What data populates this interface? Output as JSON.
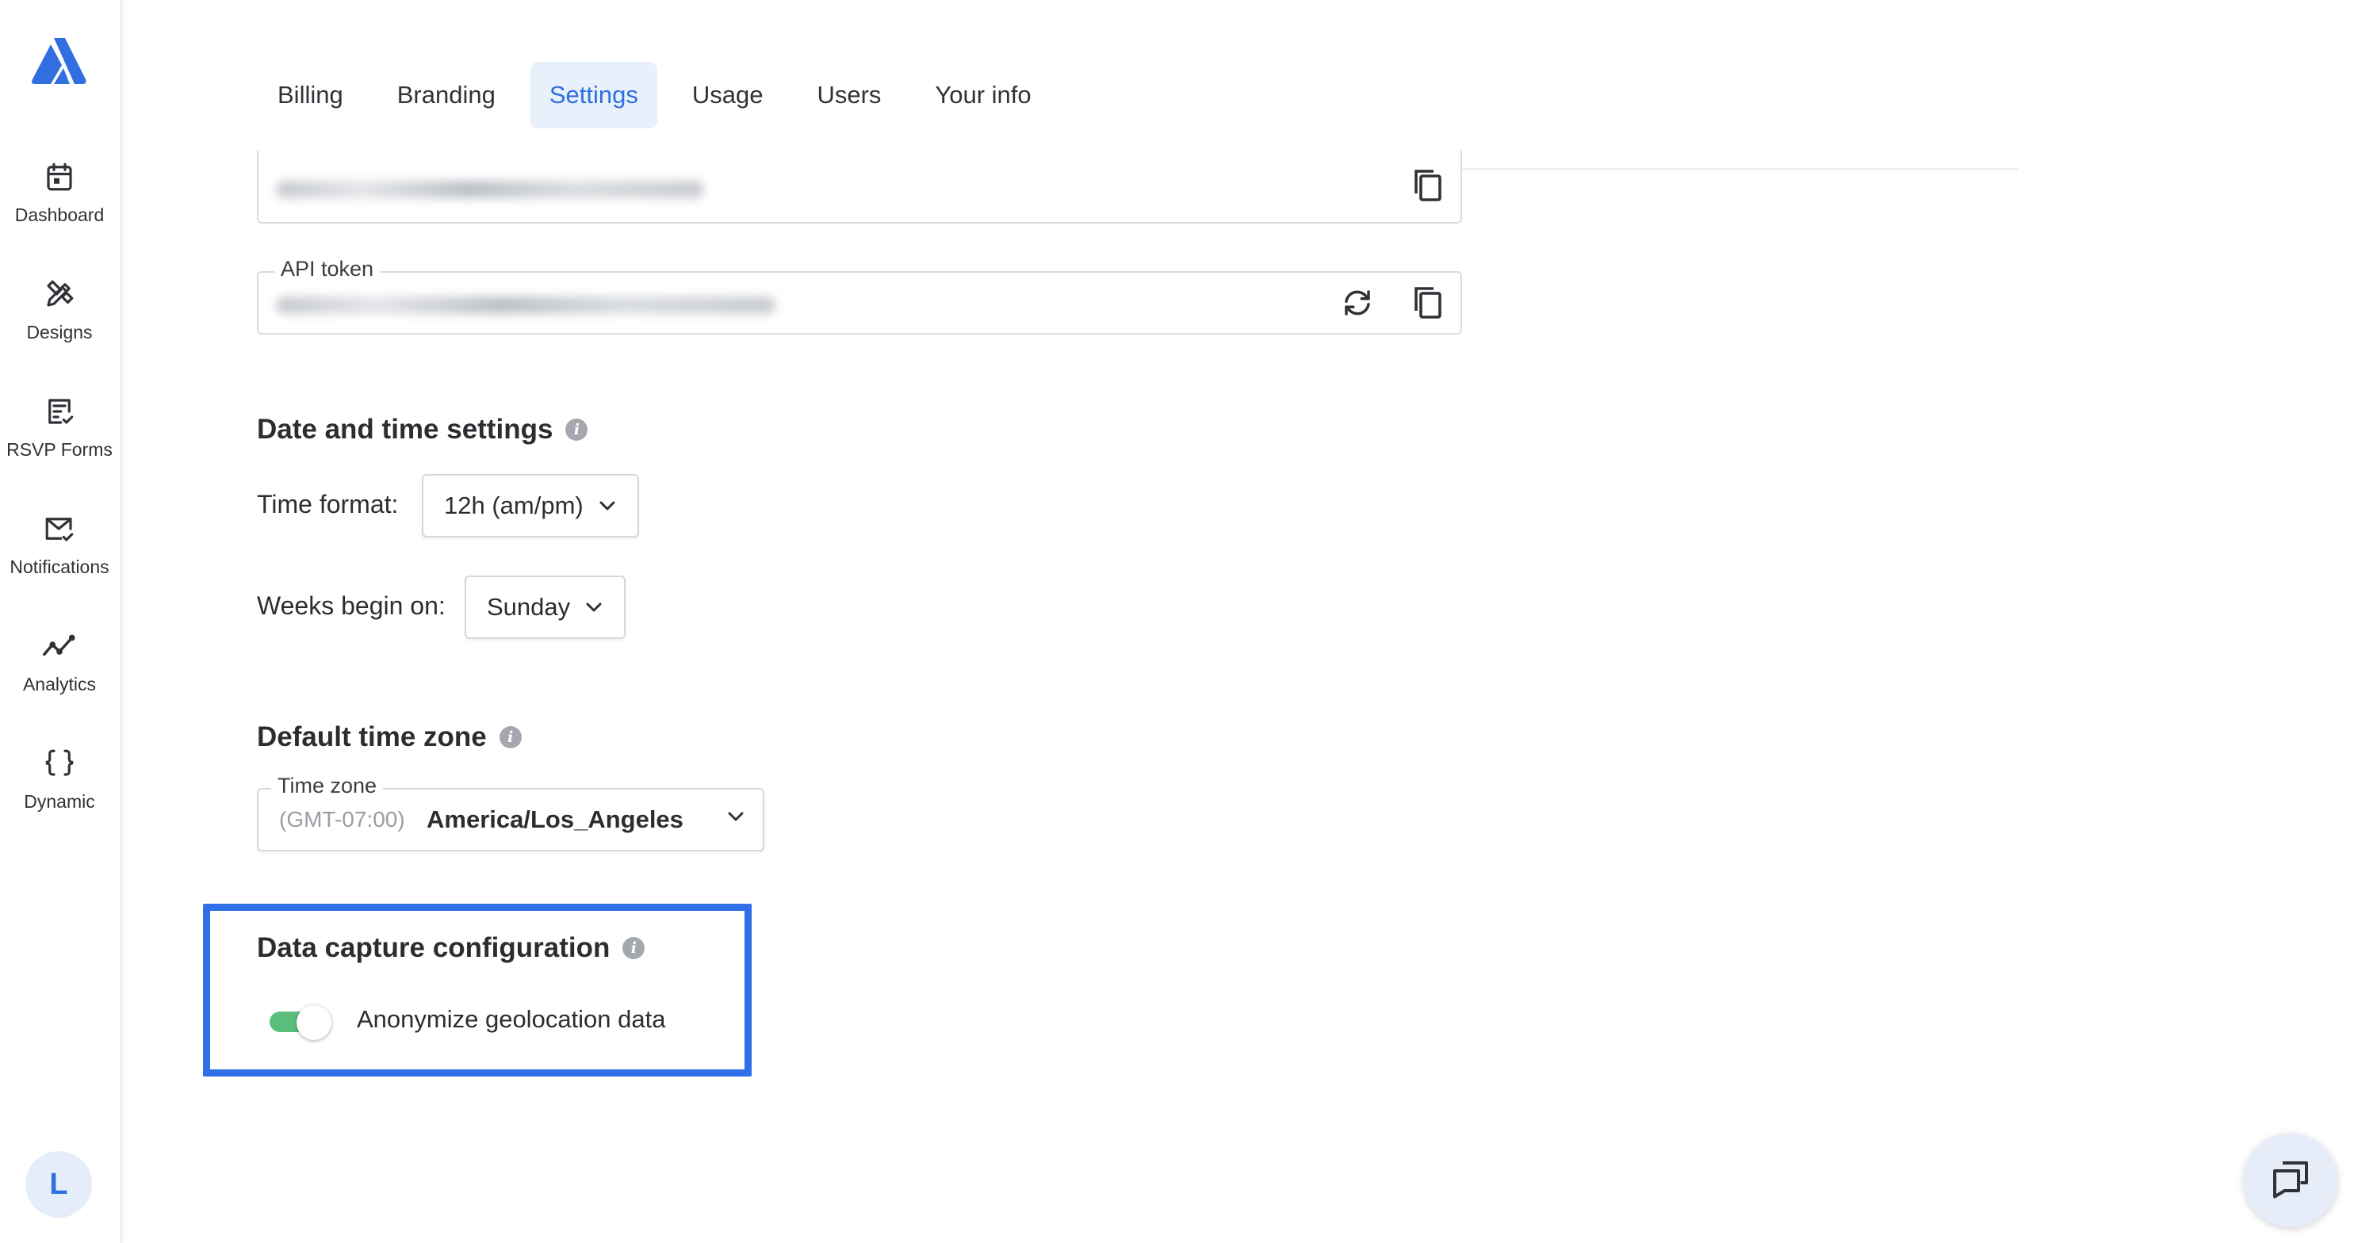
{
  "sidebar": {
    "logo": "app-logo",
    "items": [
      {
        "label": "Dashboard",
        "icon": "calendar-icon"
      },
      {
        "label": "Designs",
        "icon": "pencil-ruler-icon"
      },
      {
        "label": "RSVP Forms",
        "icon": "checklist-icon"
      },
      {
        "label": "Notifications",
        "icon": "mail-check-icon"
      },
      {
        "label": "Analytics",
        "icon": "line-chart-icon"
      },
      {
        "label": "Dynamic",
        "icon": "braces-icon"
      }
    ],
    "avatar_initial": "L"
  },
  "tabs": [
    {
      "label": "Billing",
      "active": false
    },
    {
      "label": "Branding",
      "active": false
    },
    {
      "label": "Settings",
      "active": true
    },
    {
      "label": "Usage",
      "active": false
    },
    {
      "label": "Users",
      "active": false
    },
    {
      "label": "Your info",
      "active": false
    }
  ],
  "tokens": {
    "api_token_label": "API token"
  },
  "date_time": {
    "title": "Date and time settings",
    "time_format_label": "Time format:",
    "time_format_value": "12h (am/pm)",
    "weeks_begin_label": "Weeks begin on:",
    "weeks_begin_value": "Sunday"
  },
  "timezone": {
    "title": "Default time zone",
    "field_label": "Time zone",
    "offset": "(GMT-07:00)",
    "value": "America/Los_Angeles"
  },
  "data_capture": {
    "title": "Data capture configuration",
    "toggle_label": "Anonymize geolocation data",
    "toggle_on": true
  },
  "colors": {
    "accent": "#2f6fe0",
    "highlight_border": "#2f6fe8",
    "toggle_on": "#5bbf7c"
  }
}
